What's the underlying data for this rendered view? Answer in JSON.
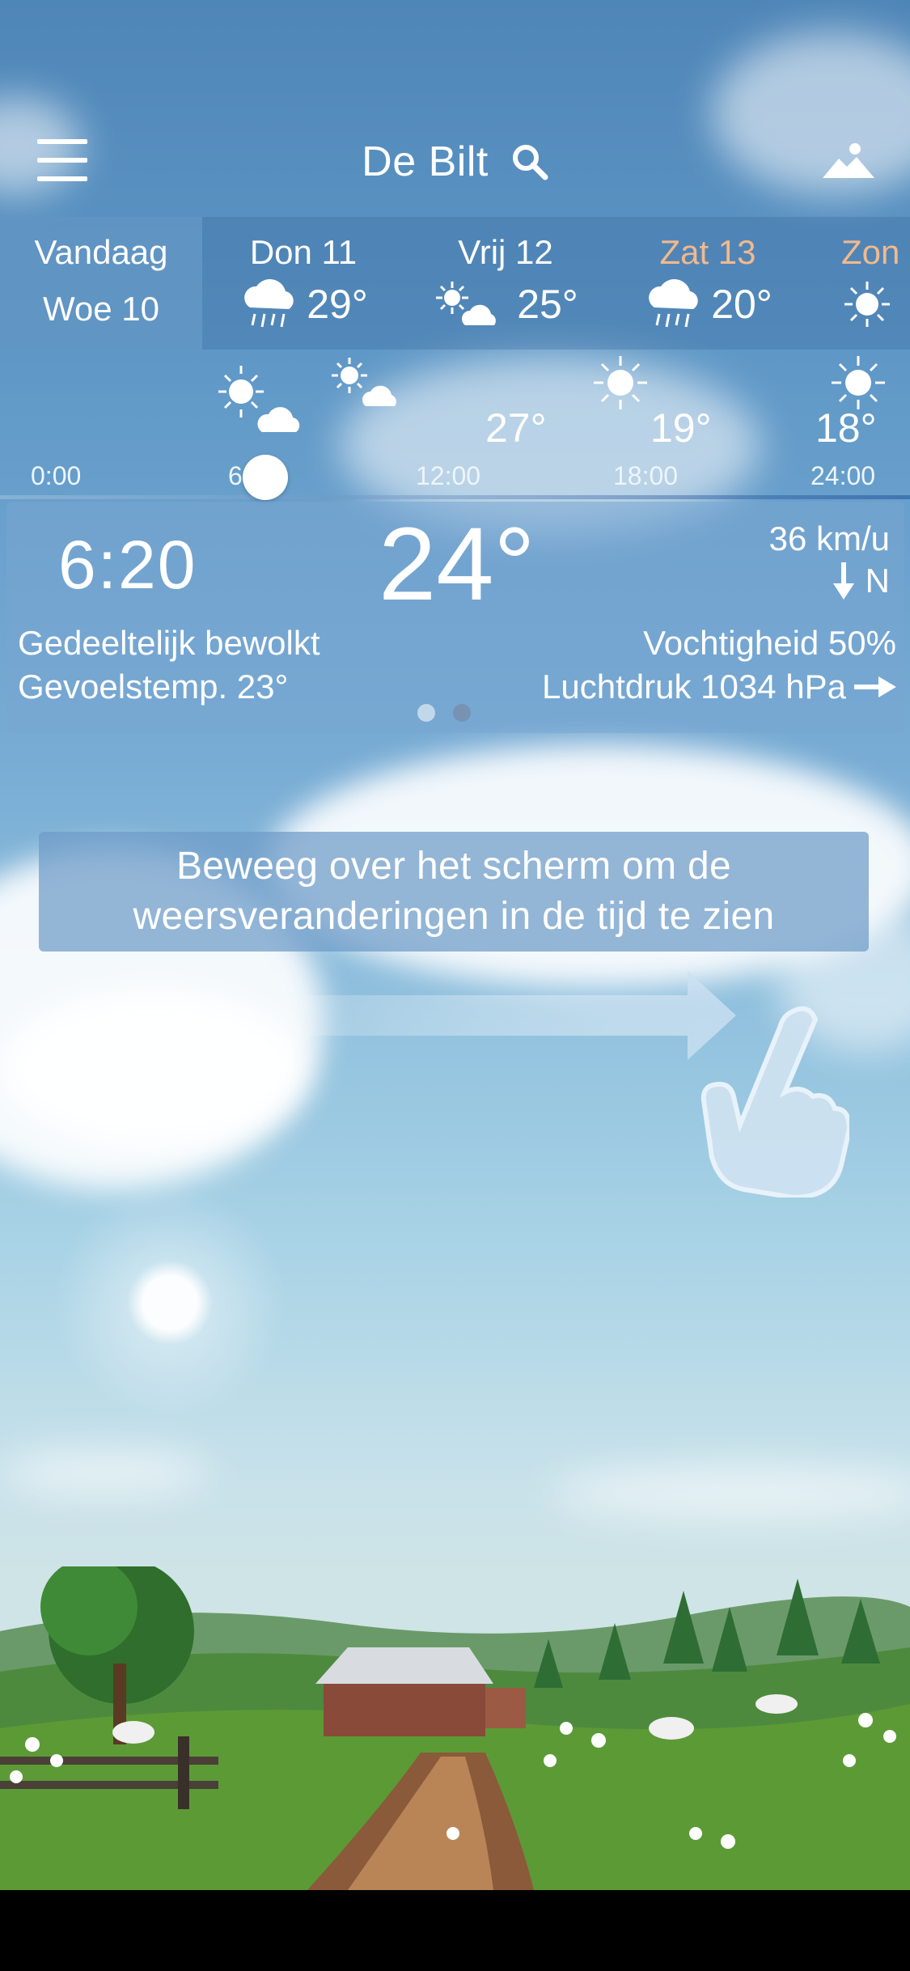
{
  "topbar": {
    "city": "De Bilt",
    "menu_icon": "menu-icon",
    "search_icon": "search-icon",
    "background_icon": "mountain-icon"
  },
  "days": [
    {
      "line1": "Vandaag",
      "line2": "Woe 10",
      "selected": true
    },
    {
      "name": "Don 11",
      "icon": "rain-cloud-icon",
      "temp": "29°"
    },
    {
      "name": "Vrij 12",
      "icon": "sun-cloud-icon",
      "temp": "25°"
    },
    {
      "name": "Zat 13",
      "icon": "rain-cloud-icon",
      "temp": "20°",
      "weekend": true
    },
    {
      "name": "Zon",
      "icon": "sun-icon",
      "weekend": true
    }
  ],
  "hourly": {
    "temps": [
      "27°",
      "19°",
      "18°"
    ],
    "labels": [
      "0:00",
      "6",
      "12:00",
      "18:00",
      "24:00"
    ]
  },
  "current": {
    "time": "6:20",
    "temp": "24°",
    "wind_speed": "36 km/u",
    "wind_dir": "N",
    "condition": "Gedeeltelijk bewolkt",
    "feels_like": "Gevoelstemp. 23°",
    "humidity": "Vochtigheid 50%",
    "pressure": "Luchtdruk 1034 hPa"
  },
  "hint": {
    "line1": "Beweeg over het scherm om de",
    "line2": "weersveranderingen in de tijd te zien"
  },
  "colors": {
    "sky_top": "#4f86b8",
    "weekend": "#f2b98c",
    "panel": "#78a5d2"
  }
}
